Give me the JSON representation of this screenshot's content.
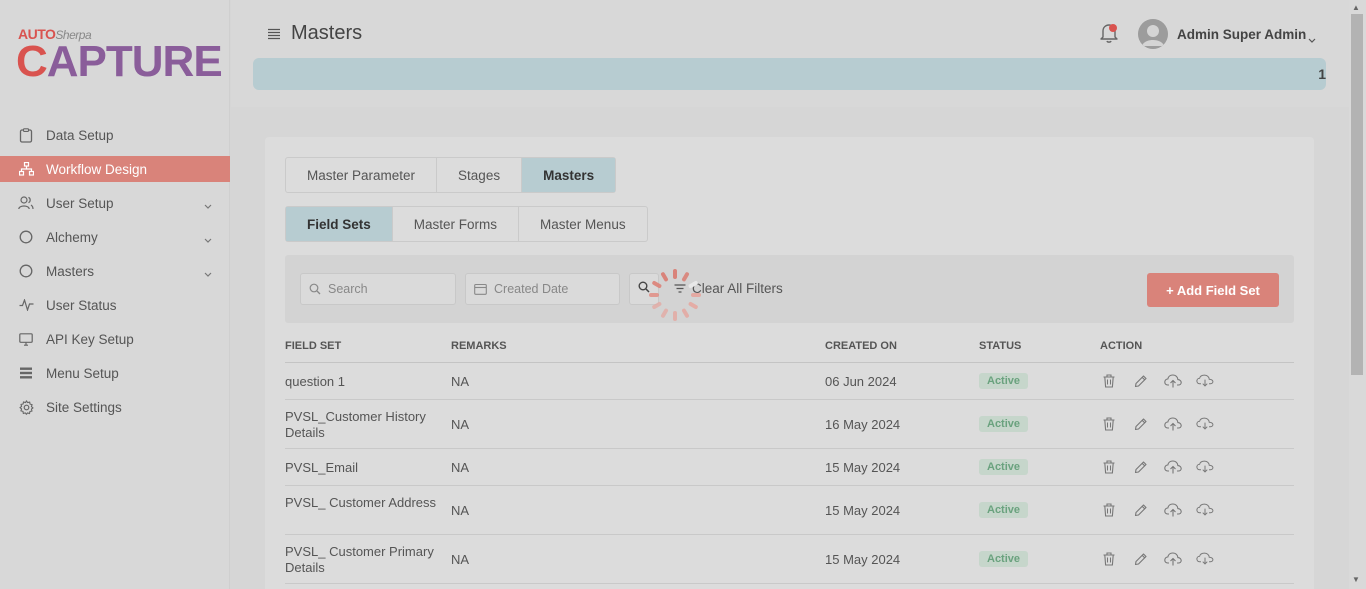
{
  "app": {
    "logo_top": "AUTO",
    "logo_top_sub": "Sherpa",
    "logo_main_c": "C",
    "logo_main_rest": "APTURE"
  },
  "sidebar": {
    "items": [
      {
        "label": "Data Setup",
        "icon": "clipboard-icon"
      },
      {
        "label": "Workflow Design",
        "icon": "sitemap-icon",
        "active": true
      },
      {
        "label": "User Setup",
        "icon": "users-icon",
        "expandable": true
      },
      {
        "label": "Alchemy",
        "icon": "circle-icon",
        "expandable": true
      },
      {
        "label": "Masters",
        "icon": "circle-icon",
        "expandable": true
      },
      {
        "label": "User Status",
        "icon": "activity-icon"
      },
      {
        "label": "API Key Setup",
        "icon": "monitor-icon"
      },
      {
        "label": "Menu Setup",
        "icon": "list-icon"
      },
      {
        "label": "Site Settings",
        "icon": "gear-icon"
      }
    ]
  },
  "header": {
    "title": "Masters",
    "user_name": "Admin Super Admin",
    "banner_value": "1"
  },
  "tabs_primary": [
    {
      "label": "Master Parameter"
    },
    {
      "label": "Stages"
    },
    {
      "label": "Masters",
      "active": true
    }
  ],
  "tabs_secondary": [
    {
      "label": "Field Sets",
      "active": true
    },
    {
      "label": "Master Forms"
    },
    {
      "label": "Master Menus"
    }
  ],
  "filters": {
    "search_placeholder": "Search",
    "date_placeholder": "Created Date",
    "clear_label": "Clear All Filters",
    "add_label": "+ Add Field Set"
  },
  "table": {
    "headers": {
      "field_set": "FIELD SET",
      "remarks": "REMARKS",
      "created_on": "CREATED ON",
      "status": "STATUS",
      "action": "ACTION"
    },
    "rows": [
      {
        "field_set": "question 1",
        "remarks": "NA",
        "created_on": "06 Jun 2024",
        "status": "Active"
      },
      {
        "field_set": "PVSL_Customer History Details",
        "remarks": "NA",
        "created_on": "16 May 2024",
        "status": "Active"
      },
      {
        "field_set": "PVSL_Email",
        "remarks": "NA",
        "created_on": "15 May 2024",
        "status": "Active"
      },
      {
        "field_set": "PVSL_ Customer Address",
        "remarks": "NA",
        "created_on": "15 May 2024",
        "status": "Active"
      },
      {
        "field_set": "PVSL_ Customer Primary Details",
        "remarks": "NA",
        "created_on": "15 May 2024",
        "status": "Active"
      }
    ]
  },
  "colors": {
    "accent": "#d9837a",
    "highlight": "#b7ccd1",
    "brand_purple": "#8a5d9a",
    "brand_red": "#d9534f"
  }
}
